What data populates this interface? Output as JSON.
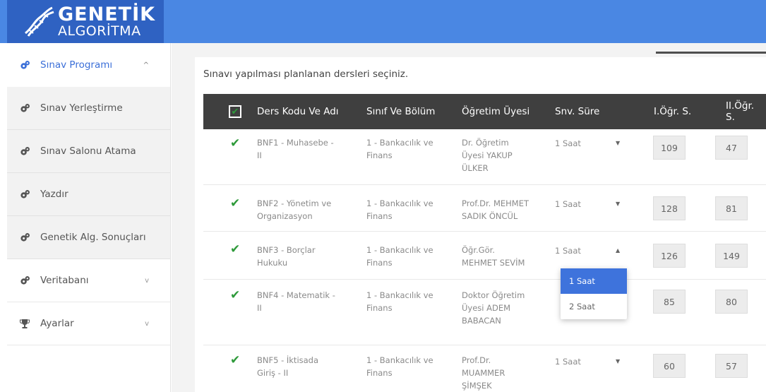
{
  "brand": {
    "title": "GENETİK",
    "subtitle": "ALGORİTMA"
  },
  "sidebar": {
    "items": [
      {
        "label": "Sınav Programı",
        "icon": "gears-icon",
        "chevron": "^"
      },
      {
        "label": "Sınav Yerleştirme",
        "icon": "gears-icon"
      },
      {
        "label": "Sınav Salonu Atama",
        "icon": "gears-icon"
      },
      {
        "label": "Yazdır",
        "icon": "gears-icon"
      },
      {
        "label": "Genetik Alg. Sonuçları",
        "icon": "gears-icon"
      },
      {
        "label": "Veritabanı",
        "icon": "gears-icon",
        "chevron": "v"
      },
      {
        "label": "Ayarlar",
        "icon": "trophy-icon",
        "chevron": "v"
      }
    ]
  },
  "main": {
    "instruction": "Sınavı yapılması planlanan dersleri seçiniz.",
    "headers": {
      "select_all": "✔",
      "code": "Ders Kodu Ve Adı",
      "class": "Sınıf Ve Bölüm",
      "teacher": "Öğretim Üyesi",
      "duration": "Snv. Süre",
      "g1": "I.Öğr. S.",
      "g2": "II.Öğr. S."
    },
    "rows": [
      {
        "checked": "✔",
        "code1": "BNF1 - Muhasebe -",
        "code2": "II",
        "class1": "1 - Bankacılık ve",
        "class2": "Finans",
        "t1": "Dr. Öğretim",
        "t2": "Üyesi YAKUP",
        "t3": "ÜLKER",
        "duration": "1 Saat",
        "caret": "▼",
        "g1": "109",
        "g2": "47"
      },
      {
        "checked": "✔",
        "code1": "BNF2 - Yönetim ve",
        "code2": "Organizasyon",
        "class1": "1 - Bankacılık ve",
        "class2": "Finans",
        "t1": "Prof.Dr. MEHMET",
        "t2": "SADIK ÖNCÜL",
        "t3": "",
        "duration": "1 Saat",
        "caret": "▼",
        "g1": "128",
        "g2": "81"
      },
      {
        "checked": "✔",
        "code1": "BNF3 - Borçlar",
        "code2": "Hukuku",
        "class1": "1 - Bankacılık ve",
        "class2": "Finans",
        "t1": "Öğr.Gör.",
        "t2": "MEHMET SEVİM",
        "t3": "",
        "duration": "1 Saat",
        "caret": "▲",
        "g1": "126",
        "g2": "149"
      },
      {
        "checked": "✔",
        "code1": "BNF4 - Matematik -",
        "code2": "II",
        "class1": "1 - Bankacılık ve",
        "class2": "Finans",
        "t1": "Doktor Öğretim",
        "t2": "Üyesi ADEM",
        "t3": "BABACAN",
        "duration": "",
        "caret": "",
        "g1": "85",
        "g2": "80"
      },
      {
        "checked": "✔",
        "code1": "BNF5 - İktisada",
        "code2": "Giriş - II",
        "class1": "1 - Bankacılık ve",
        "class2": "Finans",
        "t1": "Prof.Dr.",
        "t2": "MUAMMER",
        "t3": "ŞİMŞEK",
        "duration": "1 Saat",
        "caret": "▼",
        "g1": "60",
        "g2": "57"
      }
    ],
    "dropdown": {
      "options": [
        "1 Saat",
        "2 Saat"
      ],
      "selected": "1 Saat"
    }
  },
  "colors": {
    "topbar": "#4a87e3",
    "logo_bg": "#2f62c2",
    "header_bg": "#3f3f3f",
    "check": "#2e9a3a",
    "accent": "#3e73dc"
  }
}
